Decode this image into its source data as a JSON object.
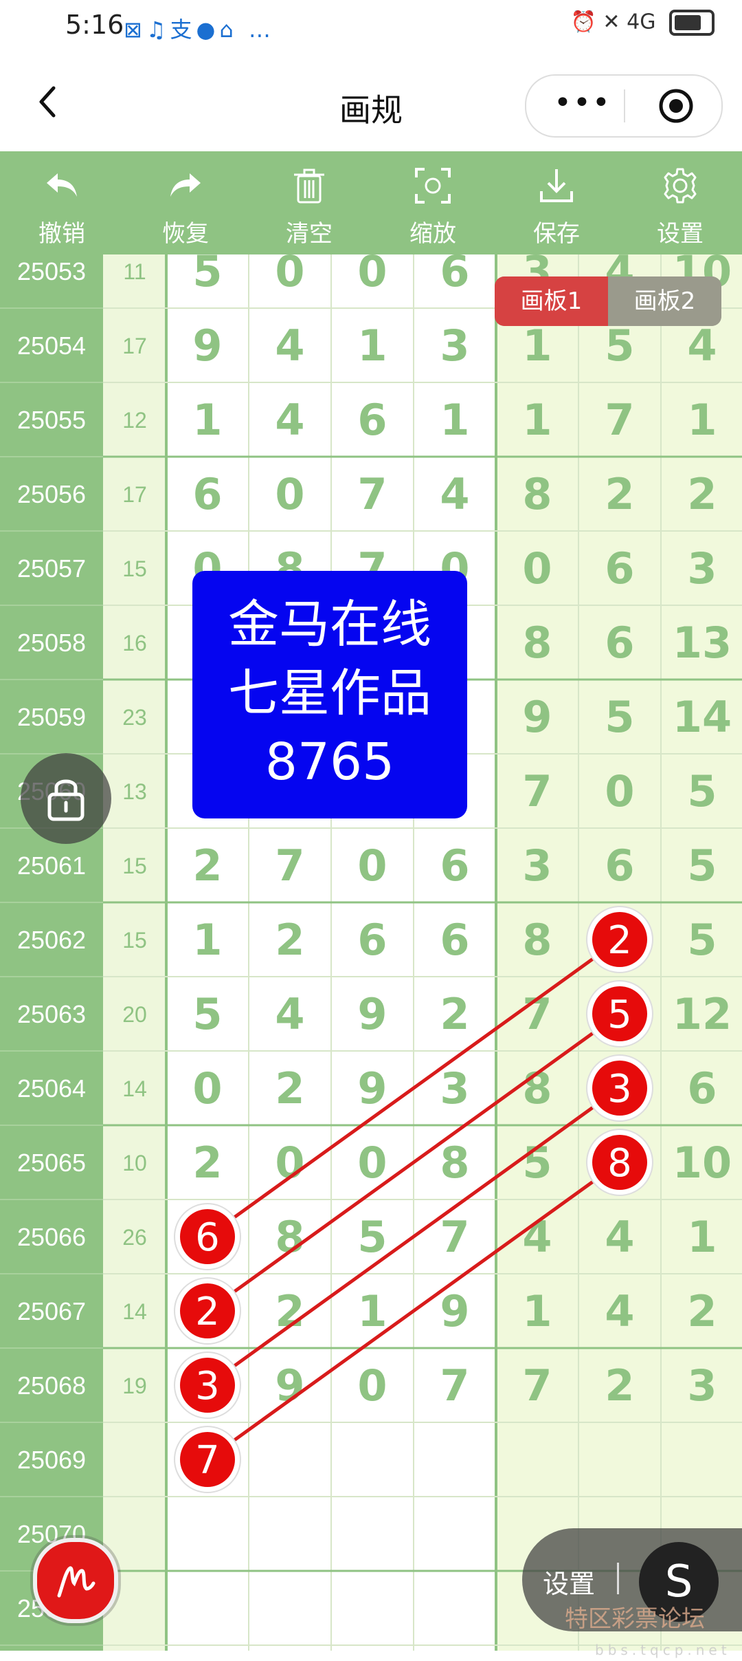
{
  "status_bar": {
    "time": "5:16",
    "app_icons": "⊠♫支●⌂ …",
    "network": "⏰ ✕ 4G"
  },
  "nav": {
    "title": "画规",
    "more": "•••"
  },
  "toolbar": {
    "items": [
      {
        "label": "撤销",
        "icon": "undo-icon"
      },
      {
        "label": "恢复",
        "icon": "redo-icon"
      },
      {
        "label": "清空",
        "icon": "trash-icon"
      },
      {
        "label": "缩放",
        "icon": "zoom-frame-icon"
      },
      {
        "label": "保存",
        "icon": "download-icon"
      },
      {
        "label": "设置",
        "icon": "gear-icon"
      }
    ]
  },
  "board_switch": {
    "tabs": [
      "画板1",
      "画板2"
    ],
    "active": 0
  },
  "promo": {
    "line1": "金马在线",
    "line2": "七星作品",
    "line3": "8765"
  },
  "table": {
    "rows": [
      {
        "id": "25053",
        "sum": "11",
        "digits": [
          "5",
          "0",
          "0",
          "6",
          "3",
          "4",
          "10"
        ]
      },
      {
        "id": "25054",
        "sum": "17",
        "digits": [
          "9",
          "4",
          "1",
          "3",
          "1",
          "5",
          "4"
        ]
      },
      {
        "id": "25055",
        "sum": "12",
        "digits": [
          "1",
          "4",
          "6",
          "1",
          "1",
          "7",
          "1"
        ]
      },
      {
        "id": "25056",
        "sum": "17",
        "digits": [
          "6",
          "0",
          "7",
          "4",
          "8",
          "2",
          "2"
        ]
      },
      {
        "id": "25057",
        "sum": "15",
        "digits": [
          "0",
          "8",
          "7",
          "0",
          "0",
          "6",
          "3"
        ]
      },
      {
        "id": "25058",
        "sum": "16",
        "digits": [
          "",
          "",
          "",
          "",
          "8",
          "6",
          "13"
        ]
      },
      {
        "id": "25059",
        "sum": "23",
        "digits": [
          "",
          "",
          "",
          "",
          "9",
          "5",
          "14"
        ]
      },
      {
        "id": "25060",
        "sum": "13",
        "digits": [
          "",
          "",
          "",
          "",
          "7",
          "0",
          "5"
        ]
      },
      {
        "id": "25061",
        "sum": "15",
        "digits": [
          "2",
          "7",
          "0",
          "6",
          "3",
          "6",
          "5"
        ]
      },
      {
        "id": "25062",
        "sum": "15",
        "digits": [
          "1",
          "2",
          "6",
          "6",
          "8",
          "2",
          "5"
        ]
      },
      {
        "id": "25063",
        "sum": "20",
        "digits": [
          "5",
          "4",
          "9",
          "2",
          "7",
          "5",
          "12"
        ]
      },
      {
        "id": "25064",
        "sum": "14",
        "digits": [
          "0",
          "2",
          "9",
          "3",
          "8",
          "3",
          "6"
        ]
      },
      {
        "id": "25065",
        "sum": "10",
        "digits": [
          "2",
          "0",
          "0",
          "8",
          "5",
          "8",
          "10"
        ]
      },
      {
        "id": "25066",
        "sum": "26",
        "digits": [
          "6",
          "8",
          "5",
          "7",
          "4",
          "4",
          "1"
        ]
      },
      {
        "id": "25067",
        "sum": "14",
        "digits": [
          "2",
          "2",
          "1",
          "9",
          "1",
          "4",
          "2"
        ]
      },
      {
        "id": "25068",
        "sum": "19",
        "digits": [
          "3",
          "9",
          "0",
          "7",
          "7",
          "2",
          "3"
        ]
      },
      {
        "id": "25069",
        "sum": "",
        "digits": [
          "",
          "",
          "",
          "",
          "",
          "",
          ""
        ]
      },
      {
        "id": "25070",
        "sum": "",
        "digits": [
          "",
          "",
          "",
          "",
          "",
          "",
          ""
        ]
      },
      {
        "id": "25071",
        "sum": "",
        "digits": [
          "",
          "",
          "",
          "",
          "",
          "",
          ""
        ]
      }
    ],
    "markers": [
      {
        "row": 9,
        "col": 5,
        "text": "2"
      },
      {
        "row": 10,
        "col": 5,
        "text": "5"
      },
      {
        "row": 11,
        "col": 5,
        "text": "3"
      },
      {
        "row": 12,
        "col": 5,
        "text": "8"
      },
      {
        "row": 13,
        "col": 0,
        "text": "6"
      },
      {
        "row": 14,
        "col": 0,
        "text": "2"
      },
      {
        "row": 15,
        "col": 0,
        "text": "3"
      },
      {
        "row": 16,
        "col": 0,
        "text": "7"
      }
    ],
    "connections": [
      [
        0,
        4
      ],
      [
        1,
        5
      ],
      [
        2,
        6
      ],
      [
        3,
        7
      ]
    ],
    "colors": {
      "id_column": "#8fc383",
      "sum_column": "#eef7dc",
      "left_digits": "#ffffff",
      "right_digits": "#f1f9dc",
      "digit_text": "#8fc383",
      "marker": "#e60b0b",
      "line": "#d81b1b"
    }
  },
  "settings_pill": {
    "label": "设置",
    "button": "S"
  },
  "watermark": {
    "text": "特区彩票论坛",
    "sub": "bbs.tqcp.net"
  }
}
